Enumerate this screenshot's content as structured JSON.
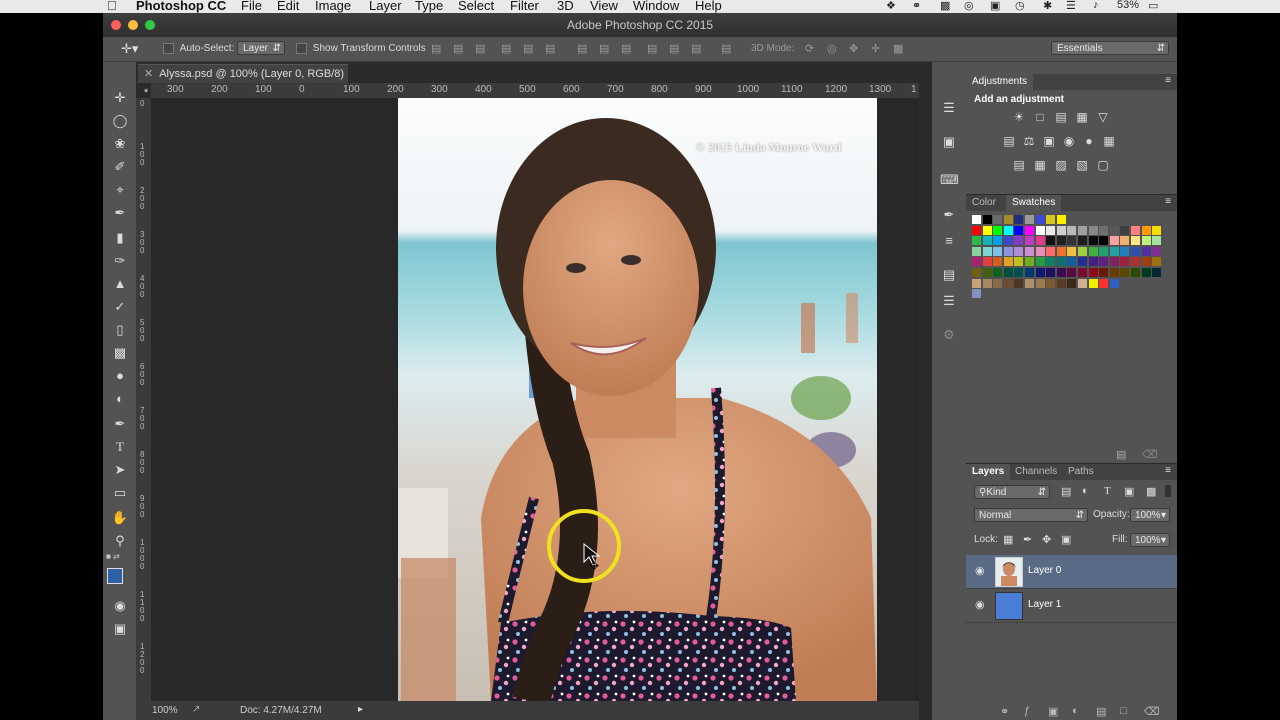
{
  "menubar": {
    "app": "Photoshop CC",
    "items": [
      "File",
      "Edit",
      "Image",
      "Layer",
      "Type",
      "Select",
      "Filter",
      "3D",
      "View",
      "Window",
      "Help"
    ],
    "battery": "53%"
  },
  "window": {
    "title": "Adobe Photoshop CC 2015"
  },
  "options": {
    "auto_select_label": "Auto-Select:",
    "auto_select_value": "Layer",
    "show_transform_label": "Show Transform Controls",
    "mode_3d_label": "3D Mode:",
    "workspace": "Essentials"
  },
  "document": {
    "tab_title": "Alyssa.psd @ 100% (Layer 0, RGB/8) *",
    "ruler_h": [
      "300",
      "200",
      "100",
      "0",
      "100",
      "200",
      "300",
      "400",
      "500",
      "600",
      "700",
      "800",
      "900",
      "1000",
      "1100",
      "1200",
      "1300",
      "1"
    ],
    "ruler_v": [
      "0",
      "1\n0\n0",
      "2\n0\n0",
      "3\n0\n0",
      "4\n0\n0",
      "5\n0\n0",
      "6\n0\n0",
      "7\n0\n0",
      "8\n0\n0",
      "9\n0\n0",
      "1\n0\n0\n0",
      "1\n1\n0\n0",
      "1\n2\n0\n0"
    ],
    "watermark": "© 2015 Linda Monroe Ward"
  },
  "status": {
    "zoom": "100%",
    "doc_size": "Doc: 4.27M/4.27M"
  },
  "adjustments": {
    "panel_title": "Adjustments",
    "subtitle": "Add an adjustment"
  },
  "swatches": {
    "tabs": [
      "Color",
      "Swatches"
    ],
    "rows": [
      [
        "#ffffff",
        "#000000",
        "#6b6b6b",
        "#a38a2c",
        "#232e7b",
        "#9b9b9b",
        "#3b4bd7",
        "#d6c91e",
        "#ffee00"
      ],
      [
        "#ff0000",
        "#ffff00",
        "#00ff00",
        "#00ffff",
        "#0000ff",
        "#ff00ff",
        "#ffffff",
        "#e8e8e8",
        "#d0d0d0",
        "#b8b8b8",
        "#a0a0a0",
        "#888888",
        "#707070",
        "#585858",
        "#404040",
        "#ff8080",
        "#ff9a00",
        "#f3e000"
      ],
      [
        "#2cb84a",
        "#15b4b7",
        "#00a2e8",
        "#3f48cc",
        "#7f3fbf",
        "#bd3fbf",
        "#e33b87",
        "#111111",
        "#222222",
        "#333333",
        "#1c1c1c",
        "#0b0b0b",
        "#000000",
        "#f7a1a1",
        "#f0b070",
        "#ffe680",
        "#bff080",
        "#a6e3a1"
      ],
      [
        "#8ad0a0",
        "#7fd3d3",
        "#7fbfe8",
        "#8c94e0",
        "#ae8cd6",
        "#d08cd0",
        "#e88cb8",
        "#ff6a6a",
        "#f07030",
        "#f0c040",
        "#a0d040",
        "#40b040",
        "#20a070",
        "#20a0a0",
        "#2080c0",
        "#3050b0",
        "#5030a0",
        "#803090"
      ],
      [
        "#b02070",
        "#e04040",
        "#d06020",
        "#e0a020",
        "#c0c020",
        "#70b020",
        "#20a040",
        "#108060",
        "#107070",
        "#1060a0",
        "#203090",
        "#402080",
        "#602080",
        "#802060",
        "#a02040",
        "#b03030",
        "#a04010",
        "#a07010"
      ],
      [
        "#706010",
        "#406010",
        "#106020",
        "#005040",
        "#005050",
        "#003870",
        "#101870",
        "#200f60",
        "#3a0a50",
        "#5a0a40",
        "#7a0a30",
        "#8a0a1a",
        "#6a1a00",
        "#6a3a00",
        "#5a4a00",
        "#2a4a00",
        "#003a20",
        "#002a30"
      ],
      [
        "#c7a17a",
        "#a58860",
        "#8a6a4a",
        "#6b4e35",
        "#4d3625",
        "#b0906a",
        "#9a7a50",
        "#7a5a30",
        "#5a3a20",
        "#3a2a18",
        "#d0b090",
        "#f0f000",
        "#ff3030",
        "#3060c0"
      ],
      [
        "#8090c0"
      ]
    ]
  },
  "layers": {
    "tabs": [
      "Layers",
      "Channels",
      "Paths"
    ],
    "filter_kind": "Kind",
    "blend_mode": "Normal",
    "opacity_label": "Opacity:",
    "opacity": "100%",
    "lock_label": "Lock:",
    "fill_label": "Fill:",
    "fill": "100%",
    "items": [
      {
        "name": "Layer 0",
        "selected": true
      },
      {
        "name": "Layer 1",
        "selected": false
      }
    ]
  },
  "colors": {
    "selection": "#5a6b86",
    "highlight_ring": "#f0e020",
    "fg_color": "#2d62a8",
    "layer1_fill": "#4a7ed6"
  }
}
